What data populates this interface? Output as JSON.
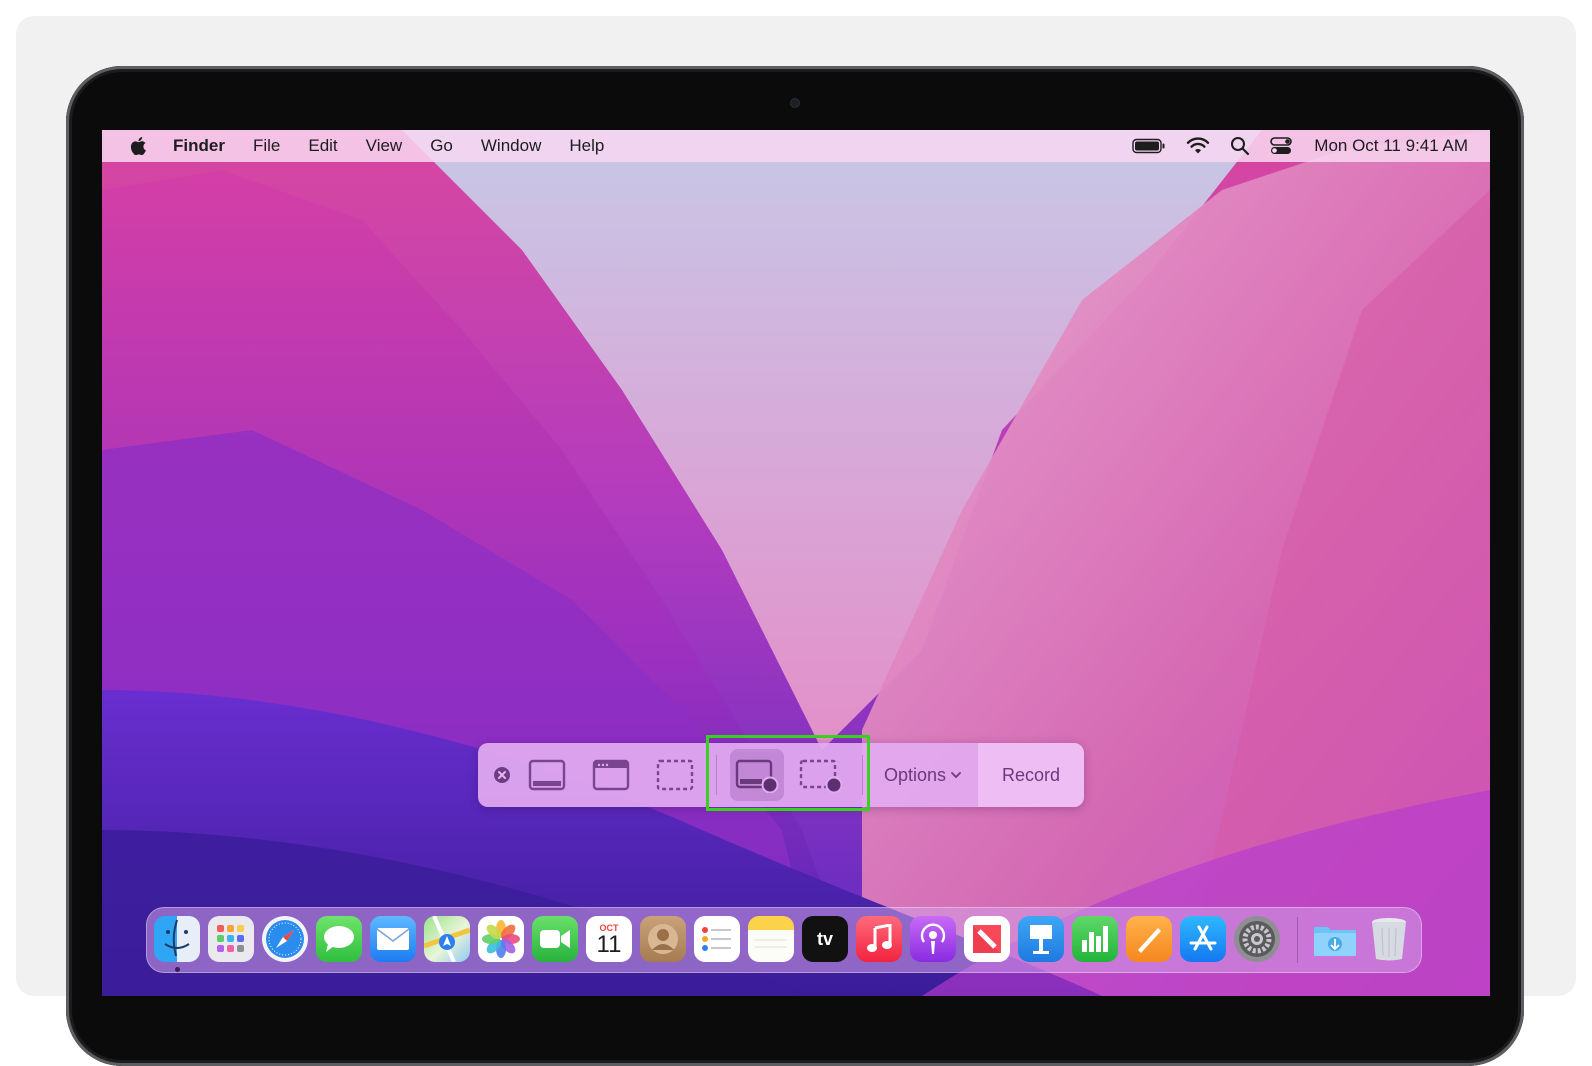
{
  "menubar": {
    "app_name": "Finder",
    "menus": [
      "File",
      "Edit",
      "View",
      "Go",
      "Window",
      "Help"
    ],
    "clock": "Mon Oct 11  9:41 AM",
    "status_icons": [
      "battery-icon",
      "wifi-icon",
      "spotlight-search-icon",
      "control-center-icon"
    ]
  },
  "toolbar": {
    "tools": [
      {
        "name": "close",
        "icon": "close-icon"
      },
      {
        "name": "capture-entire-screen",
        "icon": "capture-entire-screen-icon"
      },
      {
        "name": "capture-selected-window",
        "icon": "capture-selected-window-icon"
      },
      {
        "name": "capture-selected-portion",
        "icon": "capture-selected-portion-icon"
      },
      {
        "name": "record-entire-screen",
        "icon": "record-entire-screen-icon",
        "selected": true
      },
      {
        "name": "record-selected-portion",
        "icon": "record-selected-portion-icon"
      }
    ],
    "options_label": "Options",
    "record_label": "Record"
  },
  "dock": {
    "calendar_month": "OCT",
    "calendar_day": "11",
    "tv_label": "tv",
    "apps": [
      "Finder",
      "Launchpad",
      "Safari",
      "Messages",
      "Mail",
      "Maps",
      "Photos",
      "FaceTime",
      "Calendar",
      "Contacts",
      "Reminders",
      "Notes",
      "TV",
      "Music",
      "Podcasts",
      "News",
      "Keynote",
      "Numbers",
      "Pages",
      "App Store",
      "System Preferences",
      "Downloads",
      "Trash"
    ]
  },
  "colors": {
    "highlight": "#38d11f",
    "menubar": "#f8d6f0",
    "toolbar": "#e2aaf0"
  }
}
